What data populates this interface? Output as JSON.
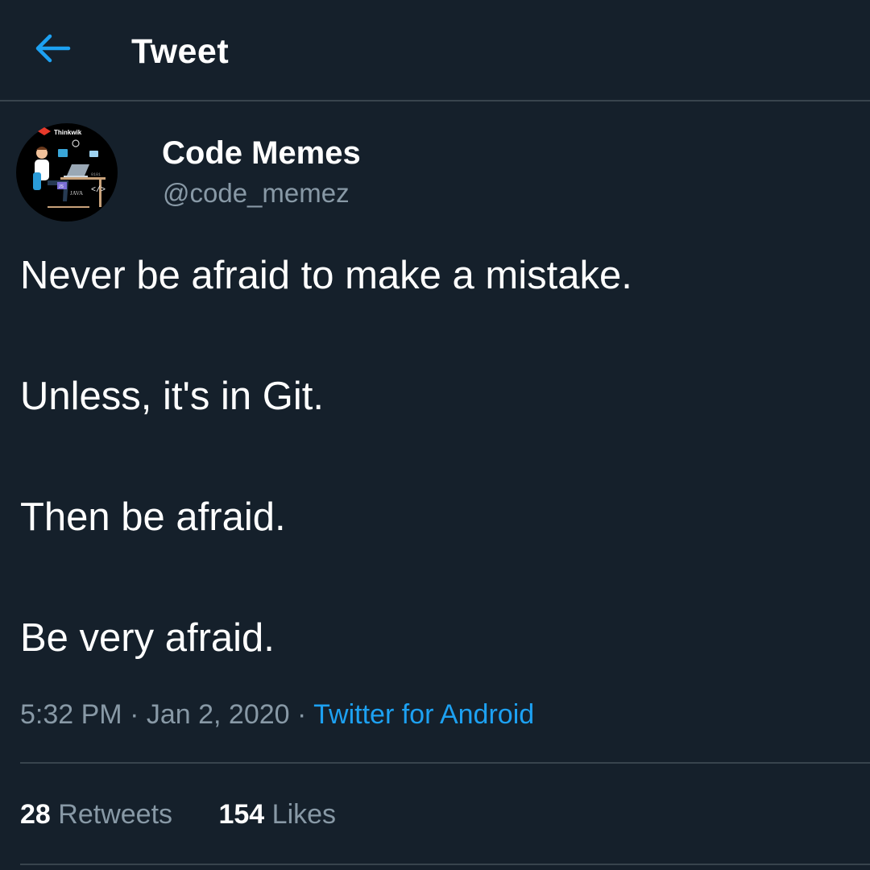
{
  "header": {
    "title": "Tweet",
    "back_icon": "arrow-left-icon"
  },
  "author": {
    "display_name": "Code Memes",
    "handle": "@code_memez",
    "avatar_logo_text": "Thinkwik"
  },
  "tweet": {
    "lines": [
      "Never be afraid to make a mistake.",
      "Unless, it's in Git.",
      "Then be afraid.",
      "Be very afraid."
    ]
  },
  "meta": {
    "time": "5:32 PM",
    "date": "Jan 2, 2020",
    "separator": " · ",
    "source": "Twitter for Android"
  },
  "stats": {
    "retweets_count": "28",
    "retweets_label": "Retweets",
    "likes_count": "154",
    "likes_label": "Likes"
  },
  "colors": {
    "background": "#15202b",
    "divider": "#38444d",
    "secondary_text": "#8899a6",
    "accent": "#1da1f2",
    "primary_text": "#ffffff"
  }
}
